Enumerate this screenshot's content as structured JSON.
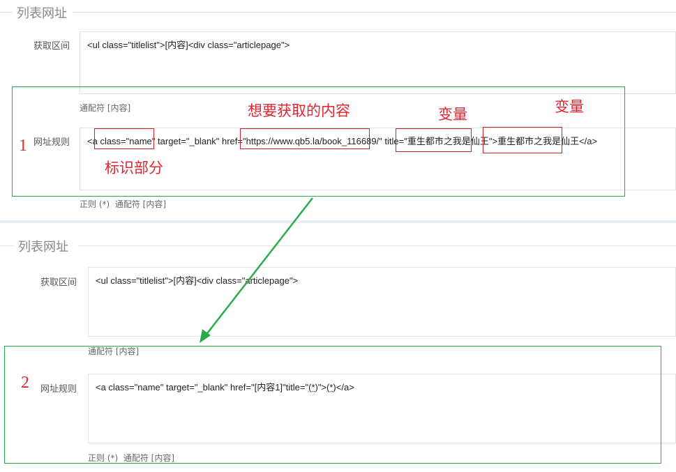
{
  "top": {
    "legend": "列表网址",
    "range_label": "获取区间",
    "range_value": "<ul class=\"titlelist\">[内容]<div class=\"articlepage\">",
    "range_hint": "通配符 [内容]",
    "rule_label": "网址规则",
    "rule_value": {
      "prefix": "<a",
      "seg_name": " class=\"name\"",
      "seg_mid": " target=\"_blank\" href=\"",
      "seg_url": "https://www.qb5.la/book_116689/",
      "seg_title_pre": "\" title=\"",
      "seg_title": "重生都市之我是仙王",
      "seg_close": "\">",
      "seg_text": "重生都市之我是仙王",
      "seg_end": "</a>"
    },
    "rule_hint_regex": "正则 (*)",
    "rule_hint_wild": "通配符 [内容]",
    "annotations": {
      "number": "1",
      "content": "想要获取的内容",
      "var1": "变量",
      "var2": "变量",
      "ident": "标识部分"
    }
  },
  "bottom": {
    "legend": "列表网址",
    "range_label": "获取区间",
    "range_value": "<ul class=\"titlelist\">[内容]<div class=\"articlepage\">",
    "range_hint": "通配符 [内容]",
    "rule_label": "网址规则",
    "rule_value": {
      "pre": "<a class=\"name\" target=\"_blank\" href=\"[内容1]\"title=\"",
      "var1": "(*)",
      "mid": "\">",
      "var2": "(*)",
      "end": "</a>"
    },
    "rule_hint_regex": "正则 (*)",
    "rule_hint_wild": "通配符 [内容]",
    "annotations": {
      "number": "2"
    }
  },
  "colors": {
    "highlight_green": "#2aa94a",
    "highlight_red": "#d0202a",
    "annotation_red": "#e0252f"
  }
}
